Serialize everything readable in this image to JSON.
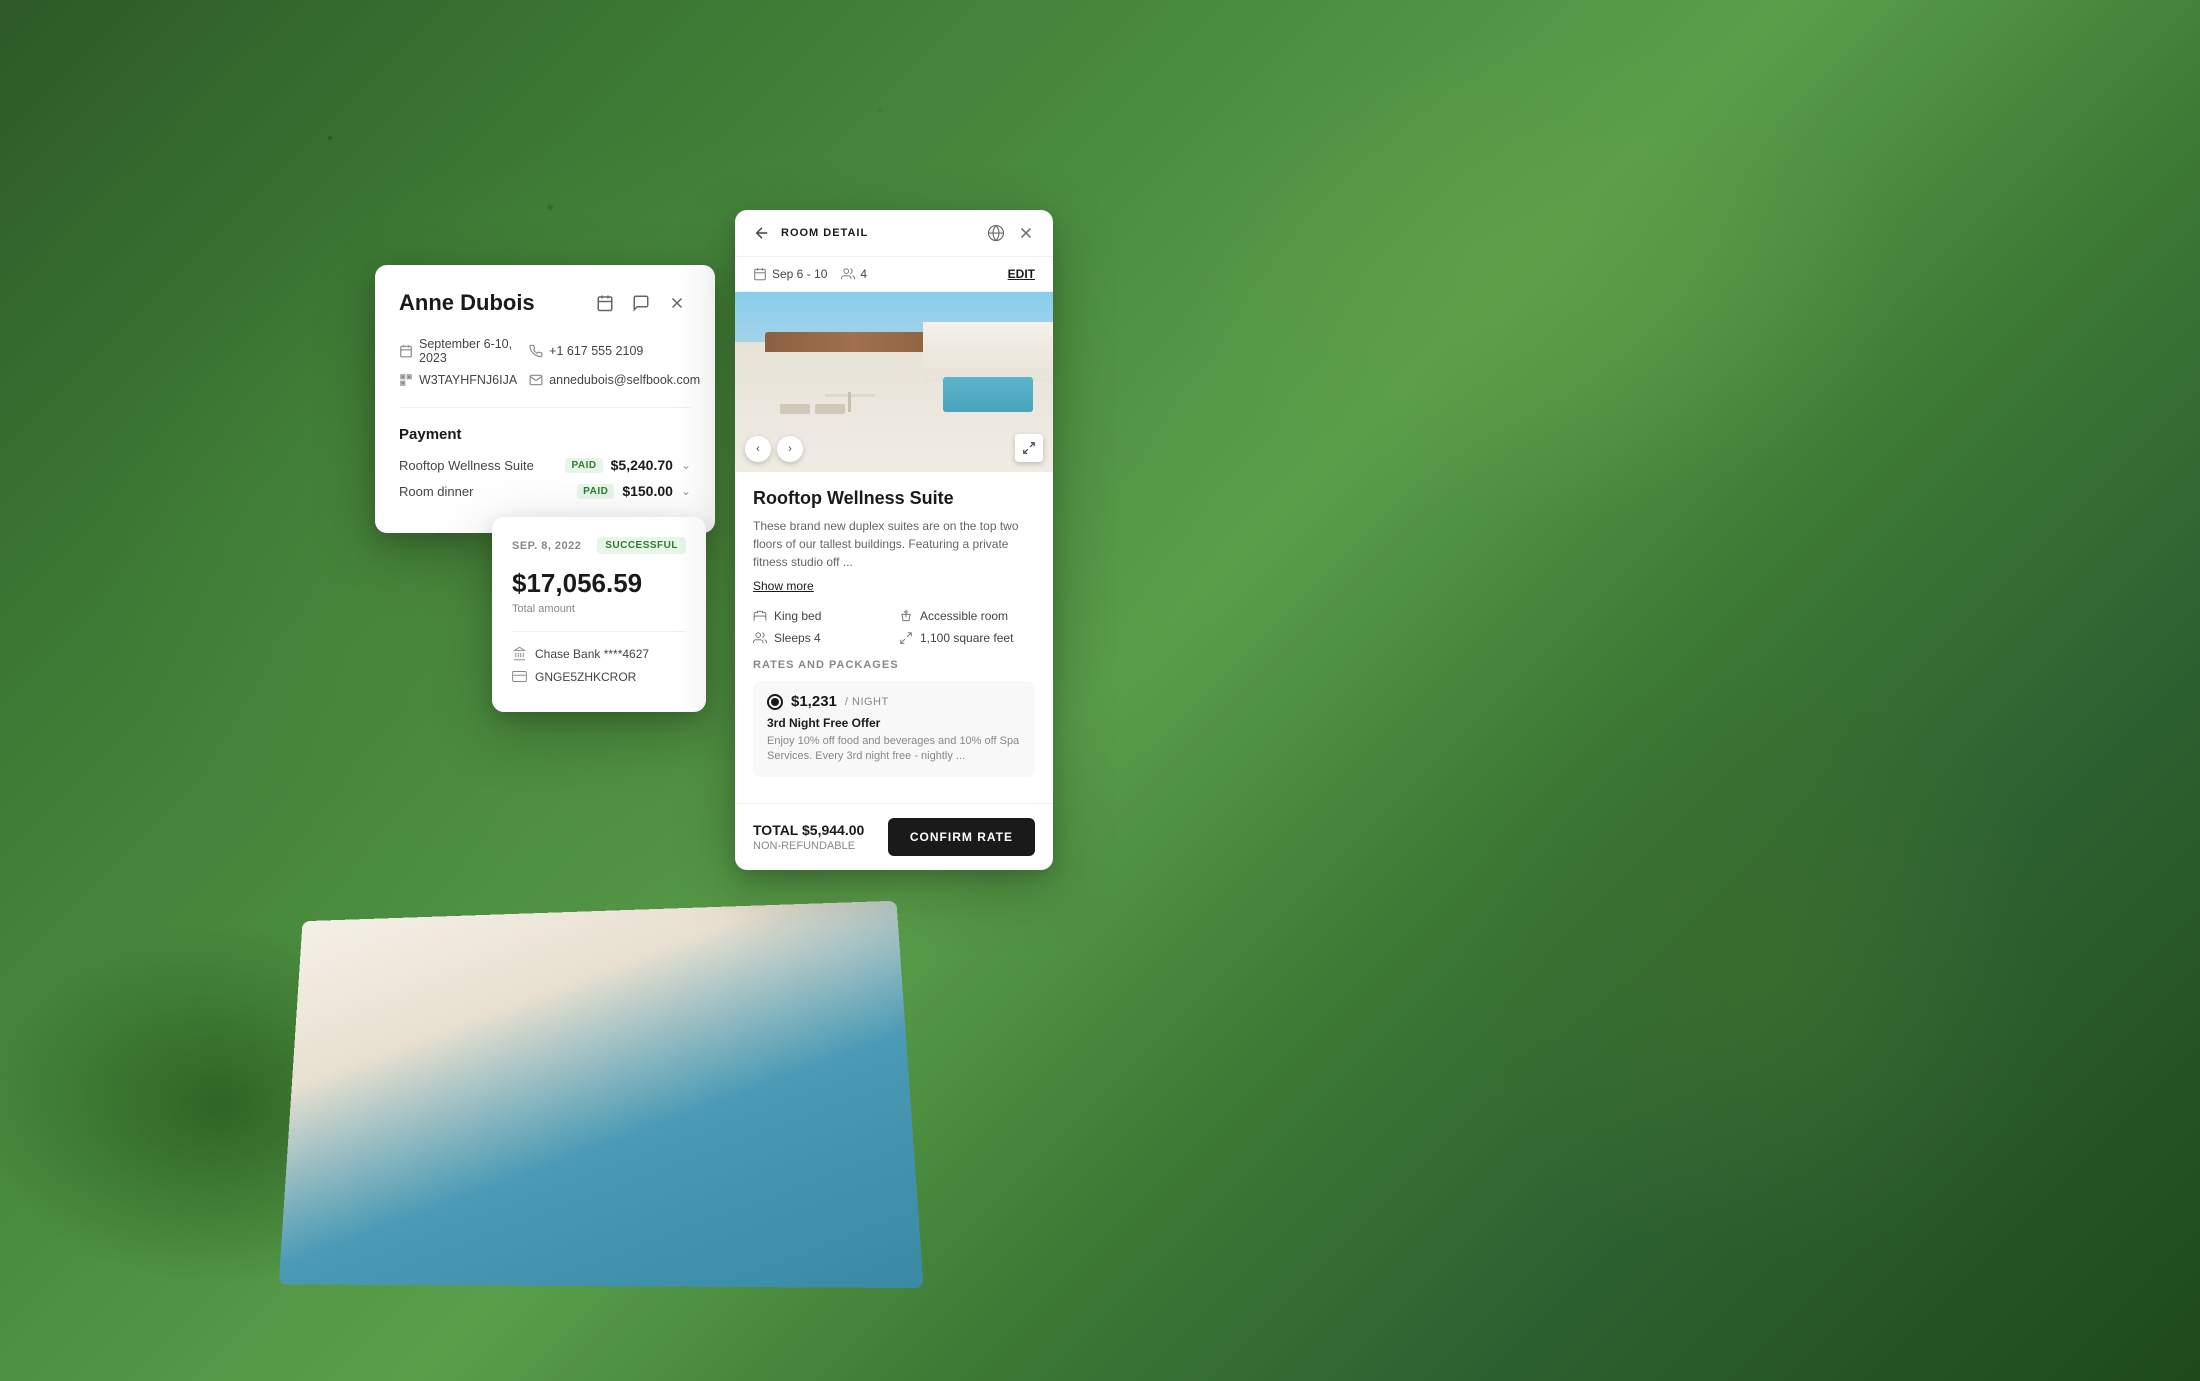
{
  "background": {
    "alt": "Aerial view of tropical property with pool and lush greenery"
  },
  "guest_card": {
    "title": "Anne Dubois",
    "actions": {
      "calendar_icon": "calendar",
      "message_icon": "message",
      "close_icon": "close"
    },
    "info": {
      "dates": "September 6-10, 2023",
      "phone": "+1 617 555 2109",
      "booking_id": "W3TAYHFNJ6IJA",
      "email": "annedubois@selfbook.com"
    },
    "payment": {
      "title": "Payment",
      "items": [
        {
          "name": "Rooftop Wellness Suite",
          "status": "PAID",
          "amount": "$5,240.70"
        },
        {
          "name": "Room dinner",
          "status": "PAID",
          "amount": "$150.00"
        }
      ]
    }
  },
  "transaction_card": {
    "date": "SEP. 8, 2022",
    "status": "SUCCESSFUL",
    "amount": "$17,056.59",
    "amount_label": "Total amount",
    "bank_name": "Chase Bank ****4627",
    "reference": "GNGE5ZHKCROR"
  },
  "room_detail_card": {
    "header": {
      "title": "ROOM DETAIL",
      "back_icon": "back-arrow",
      "globe_icon": "globe",
      "close_icon": "close"
    },
    "meta": {
      "dates": "Sep 6 - 10",
      "guests": "4",
      "edit_label": "EDIT"
    },
    "image_alt": "Rooftop pool and terrace of the wellness suite",
    "room_name": "Rooftop Wellness Suite",
    "description": "These brand new duplex suites are on the top two floors of our tallest buildings. Featuring a private fitness studio off ...",
    "show_more_label": "Show more",
    "features": [
      {
        "icon": "bed-icon",
        "label": "King bed"
      },
      {
        "icon": "accessible-icon",
        "label": "Accessible room"
      },
      {
        "icon": "person-icon",
        "label": "Sleeps 4"
      },
      {
        "icon": "size-icon",
        "label": "1,100 square feet"
      }
    ],
    "rates_title": "RATES AND PACKAGES",
    "rate": {
      "price": "$1,231",
      "unit": "/ NIGHT",
      "name": "3rd Night Free Offer",
      "description": "Enjoy 10% off food and beverages and 10% off Spa Services. Every 3rd night free - nightly ..."
    },
    "footer": {
      "total_label": "TOTAL $5,944.00",
      "refund_label": "NON-REFUNDABLE",
      "confirm_label": "CONFIRM RATE"
    }
  }
}
